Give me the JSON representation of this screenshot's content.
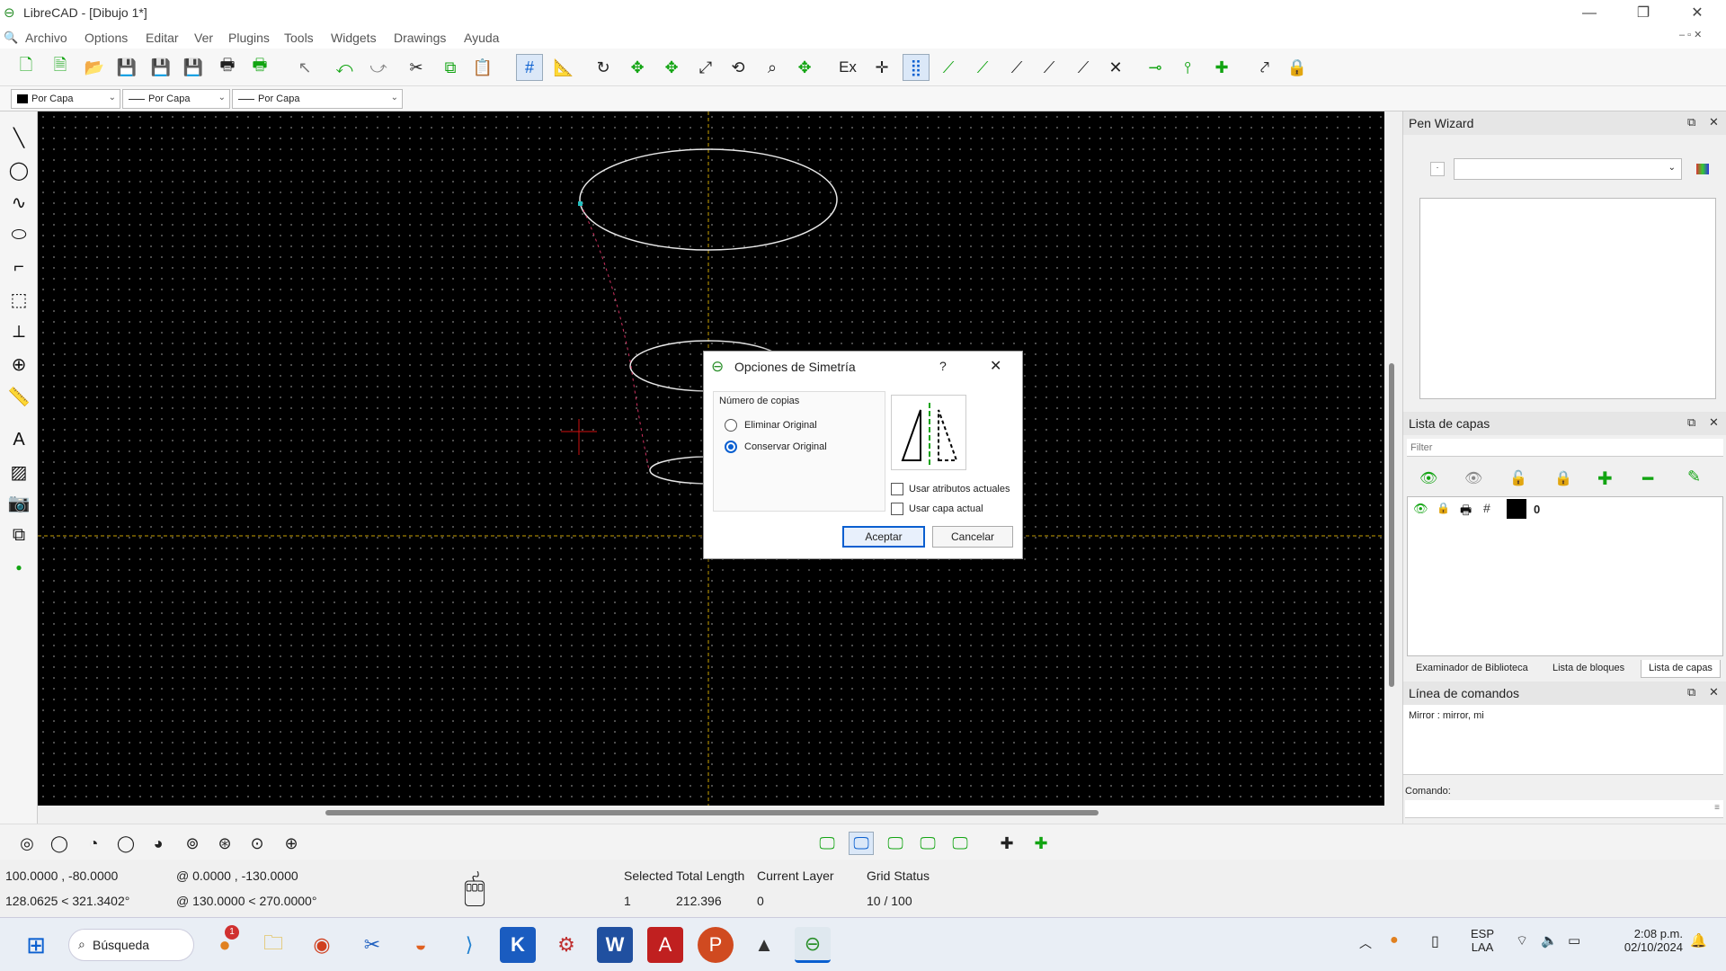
{
  "window": {
    "title": "LibreCAD - [Dibujo 1*]"
  },
  "menu": [
    "Archivo",
    "Options",
    "Editar",
    "Ver",
    "Plugins",
    "Tools",
    "Widgets",
    "Drawings",
    "Ayuda"
  ],
  "pen_toolbar": {
    "color": "Por Capa",
    "width": "Por Capa",
    "linetype": "Por Capa"
  },
  "toolbar_ex_label": "Ex",
  "dialog": {
    "title": "Opciones de Simetría",
    "help": "?",
    "group_label": "Número de copias",
    "option_delete": "Eliminar Original",
    "option_keep": "Conservar Original",
    "selected_option": "Conservar Original",
    "use_current_attributes": "Usar atributos actuales",
    "use_current_layer": "Usar capa actual",
    "ok": "Aceptar",
    "cancel": "Cancelar"
  },
  "pen_wizard": {
    "title": "Pen Wizard"
  },
  "layers": {
    "title": "Lista de capas",
    "filter_placeholder": "Filter",
    "layer_name": "0",
    "tabs": [
      "Examinador de Biblioteca",
      "Lista de bloques",
      "Lista de capas"
    ],
    "active_tab": "Lista de capas"
  },
  "command": {
    "title": "Línea de comandos",
    "history": "Mirror : mirror, mi",
    "prompt_label": "Comando:"
  },
  "status": {
    "abs_coord": "100.0000 , -80.0000",
    "abs_polar": "128.0625 < 321.3402°",
    "rel_coord": "@  0.0000 , -130.0000",
    "rel_polar": "@  130.0000 < 270.0000°",
    "selected_label": "Selected",
    "selected_value": "1",
    "total_length_label": "Total Length",
    "total_length_value": "212.396",
    "current_layer_label": "Current Layer",
    "current_layer_value": "0",
    "grid_status_label": "Grid Status",
    "grid_status_value": "10 / 100"
  },
  "taskbar": {
    "search": "Búsqueda",
    "lang": "ESP",
    "lang2": "LAA",
    "time": "2:08 p.m.",
    "date": "02/10/2024",
    "badge": "1"
  },
  "colors": {
    "accent": "#0a5fd0",
    "canvas": "#000000",
    "crosshair": "#c8a000",
    "icon_green": "#12a412"
  }
}
